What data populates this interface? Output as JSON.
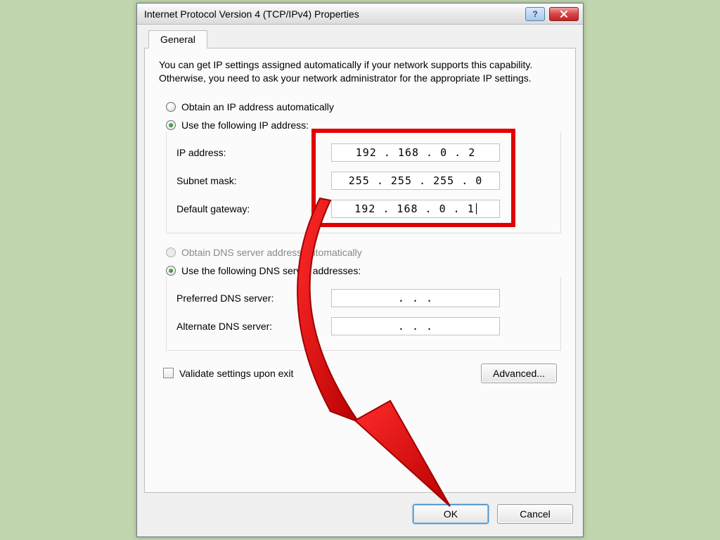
{
  "window": {
    "title": "Internet Protocol Version 4 (TCP/IPv4) Properties"
  },
  "tabs": {
    "general": "General"
  },
  "description": "You can get IP settings assigned automatically if your network supports this capability. Otherwise, you need to ask your network administrator for the appropriate IP settings.",
  "ip": {
    "obtain_auto": "Obtain an IP address automatically",
    "use_following": "Use the following IP address:",
    "address_label": "IP address:",
    "address_value": "192 . 168 .  0  .  2",
    "subnet_label": "Subnet mask:",
    "subnet_value": "255 . 255 . 255 .  0",
    "gateway_label": "Default gateway:",
    "gateway_value": "192 . 168 .  0  .  1"
  },
  "dns": {
    "obtain_auto": "Obtain DNS server address automatically",
    "use_following": "Use the following DNS server addresses:",
    "preferred_label": "Preferred DNS server:",
    "preferred_value": ".       .       .",
    "alternate_label": "Alternate DNS server:",
    "alternate_value": ".       .       ."
  },
  "validate_label": "Validate settings upon exit",
  "buttons": {
    "advanced": "Advanced...",
    "ok": "OK",
    "cancel": "Cancel"
  }
}
